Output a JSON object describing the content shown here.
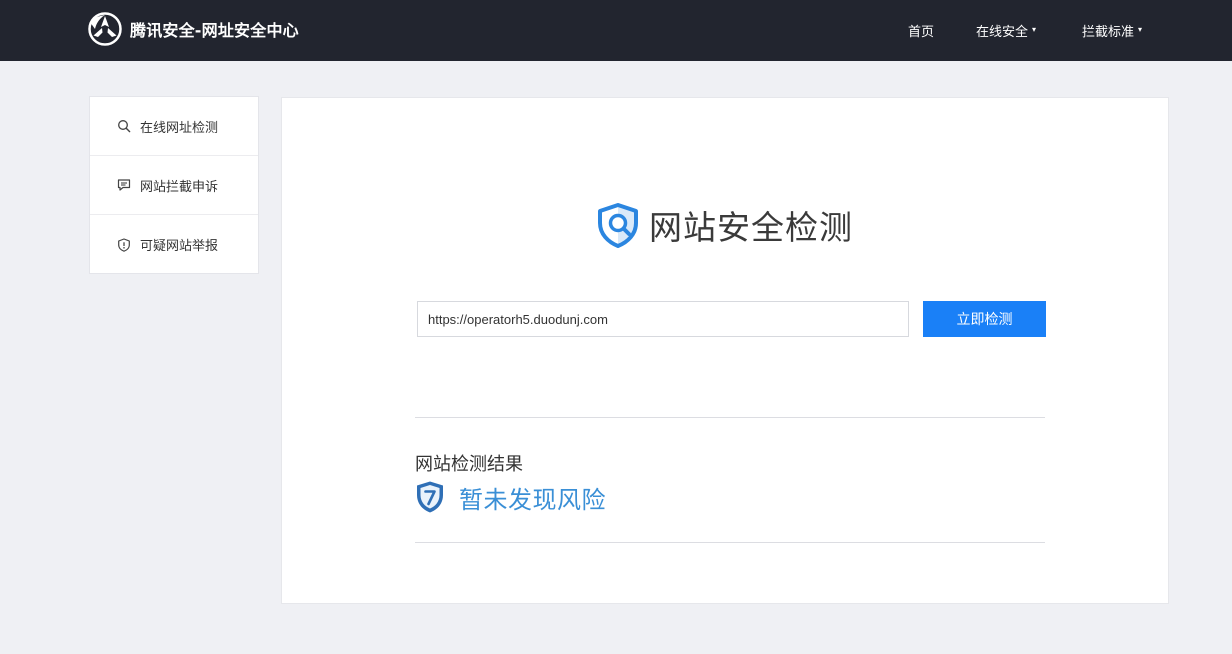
{
  "header": {
    "brand": "腾讯安全-网址安全中心",
    "logo_icon": "tencent-security-logo-icon",
    "nav": [
      {
        "label": "首页",
        "has_dropdown": false
      },
      {
        "label": "在线安全",
        "has_dropdown": true
      },
      {
        "label": "拦截标准",
        "has_dropdown": true
      }
    ],
    "caret": "▾"
  },
  "sidebar": {
    "items": [
      {
        "label": "在线网址检测",
        "icon": "search-icon"
      },
      {
        "label": "网站拦截申诉",
        "icon": "chat-bubble-icon"
      },
      {
        "label": "可疑网站举报",
        "icon": "warning-shield-icon"
      }
    ]
  },
  "main": {
    "title": "网站安全检测",
    "title_icon": "shield-search-icon",
    "url_value": "https://operatorh5.duodunj.com",
    "check_button": "立即检测",
    "result_label": "网站检测结果",
    "result_icon": "question-shield-icon",
    "result_text": "暂未发现风险"
  },
  "colors": {
    "header_bg": "#22252f",
    "page_bg": "#eff0f4",
    "accent_blue": "#1a80f7",
    "result_blue": "#3a8fd6"
  }
}
